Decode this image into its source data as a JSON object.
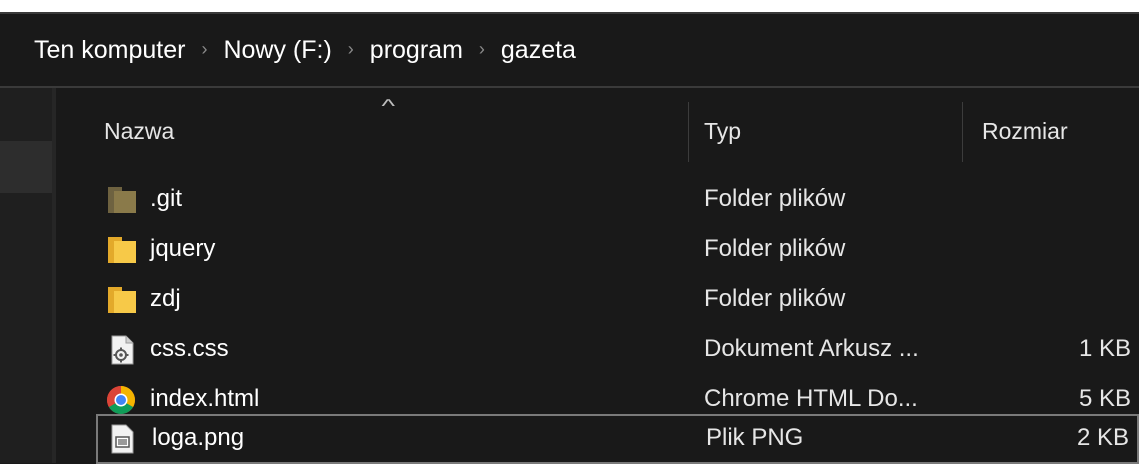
{
  "breadcrumb": {
    "items": [
      "Ten komputer",
      "Nowy (F:)",
      "program",
      "gazeta"
    ],
    "separator": "›"
  },
  "columns": {
    "name": "Nazwa",
    "type": "Typ",
    "size": "Rozmiar"
  },
  "sort": {
    "column": "name",
    "indicator": "^"
  },
  "files": [
    {
      "name": ".git",
      "type": "Folder plików",
      "size": "",
      "icon": "hidden-folder-icon"
    },
    {
      "name": "jquery",
      "type": "Folder plików",
      "size": "",
      "icon": "folder-icon"
    },
    {
      "name": "zdj",
      "type": "Folder plików",
      "size": "",
      "icon": "folder-icon"
    },
    {
      "name": "css.css",
      "type": "Dokument Arkusz ...",
      "size": "1 KB",
      "icon": "css-file-icon"
    },
    {
      "name": "index.html",
      "type": "Chrome HTML Do...",
      "size": "5 KB",
      "icon": "chrome-icon"
    },
    {
      "name": "loga.png",
      "type": "Plik PNG",
      "size": "2 KB",
      "icon": "image-file-icon"
    }
  ],
  "colors": {
    "background": "#191919",
    "folder": "#f7c948",
    "hidden_folder": "#8a7a4a",
    "selection_border": "#7a7a7a"
  }
}
